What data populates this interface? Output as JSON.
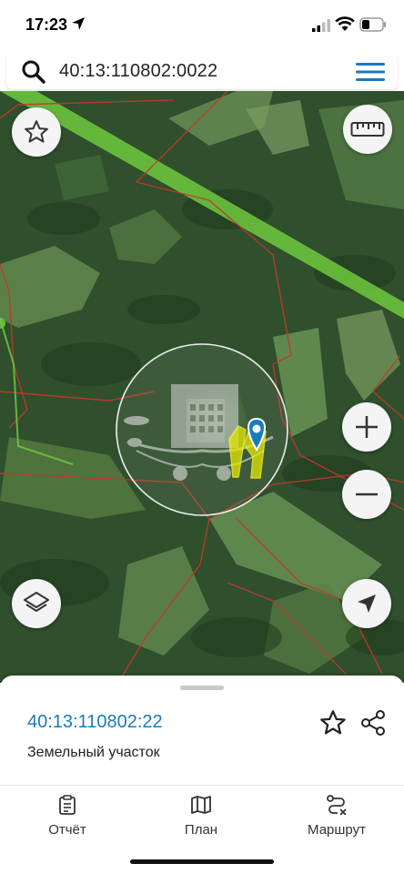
{
  "status_bar": {
    "time": "17:23",
    "icons": [
      "location-arrow-icon",
      "cellular-signal-icon",
      "wifi-icon",
      "battery-icon"
    ]
  },
  "search": {
    "query": "40:13:110802:0022",
    "icon": "search-icon",
    "menu_icon": "hamburger-menu-icon"
  },
  "map": {
    "controls": [
      "favorite-star-icon",
      "ruler-icon",
      "zoom-in-icon",
      "zoom-out-icon",
      "layers-icon",
      "navigation-arrow-icon"
    ],
    "colors": {
      "parcel_highlight": "#e6e600",
      "boundary": "#c0392b",
      "powerline_strip": "#6ec93e",
      "marker": "#1a7bb9"
    }
  },
  "sheet": {
    "parcel_id": "40:13:110802:22",
    "parcel_type": "Земельный участок"
  },
  "nav": {
    "items": [
      {
        "label": "Отчёт",
        "icon": "report-clipboard-icon"
      },
      {
        "label": "План",
        "icon": "map-plan-icon"
      },
      {
        "label": "Маршрут",
        "icon": "route-icon"
      }
    ]
  }
}
